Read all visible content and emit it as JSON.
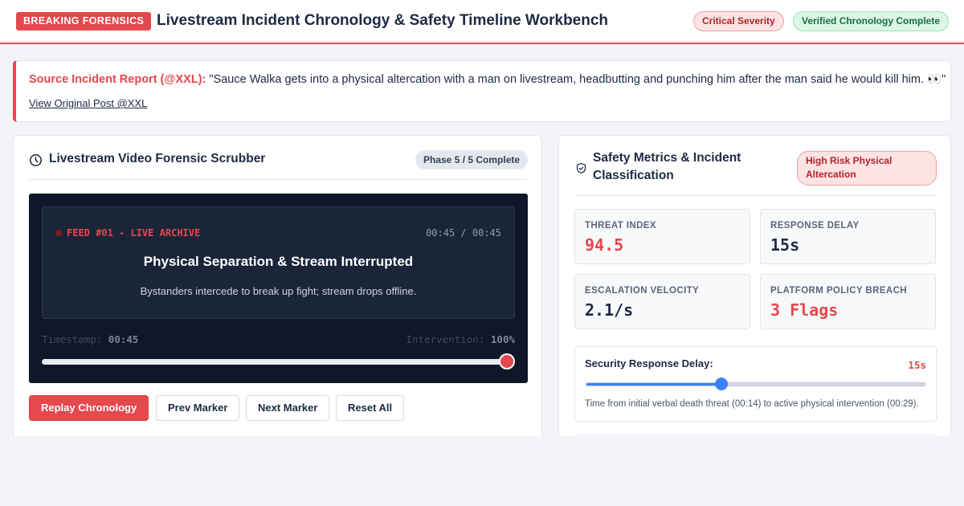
{
  "header": {
    "badge": "BREAKING FORENSICS",
    "title": "Livestream Incident Chronology & Safety Timeline Workbench",
    "severity_pill": "Critical Severity",
    "status_pill": "Verified Chronology Complete"
  },
  "report": {
    "label": "Source Incident Report (@XXL):",
    "quote": "\"Sauce Walka gets into a physical altercation with a man on livestream, headbutting and punching him after the man said he would kill him. 👀\"",
    "link": "View Original Post @XXL"
  },
  "scrubber": {
    "title": "Livestream Video Forensic Scrubber",
    "phase": "Phase 5 / 5 Complete",
    "feed_label": "FEED #01 - LIVE ARCHIVE",
    "feed_time": "00:45 / 00:45",
    "frame_title": "Physical Separation & Stream Interrupted",
    "frame_desc": "Bystanders intercede to break up fight; stream drops offline.",
    "timestamp_label": "Timestamp:",
    "timestamp_value": "00:45",
    "intervention_label": "Intervention:",
    "intervention_value": "100%",
    "progress_fraction": 1.0,
    "buttons": {
      "replay": "Replay Chronology",
      "prev": "Prev Marker",
      "next": "Next Marker",
      "reset": "Reset All"
    }
  },
  "safety": {
    "title": "Safety Metrics & Incident Classification",
    "risk_pill": "High Risk Physical Altercation",
    "metrics": [
      {
        "label": "THREAT INDEX",
        "value": "94.5"
      },
      {
        "label": "RESPONSE DELAY",
        "value": "15s"
      },
      {
        "label": "ESCALATION VELOCITY",
        "value": "2.1/s"
      },
      {
        "label": "PLATFORM POLICY BREACH",
        "value": "3 Flags"
      }
    ],
    "delay": {
      "label": "Security Response Delay:",
      "value": "15s",
      "slider_fraction": 0.4,
      "note": "Time from initial verbal death threat (00:14) to active physical intervention (00:29)."
    }
  },
  "colors": {
    "accent": "#e5484d",
    "navy": "#1e2a44",
    "video_bg": "#0e1628",
    "slider_blue": "#3b82f6",
    "success": "#15703d"
  }
}
